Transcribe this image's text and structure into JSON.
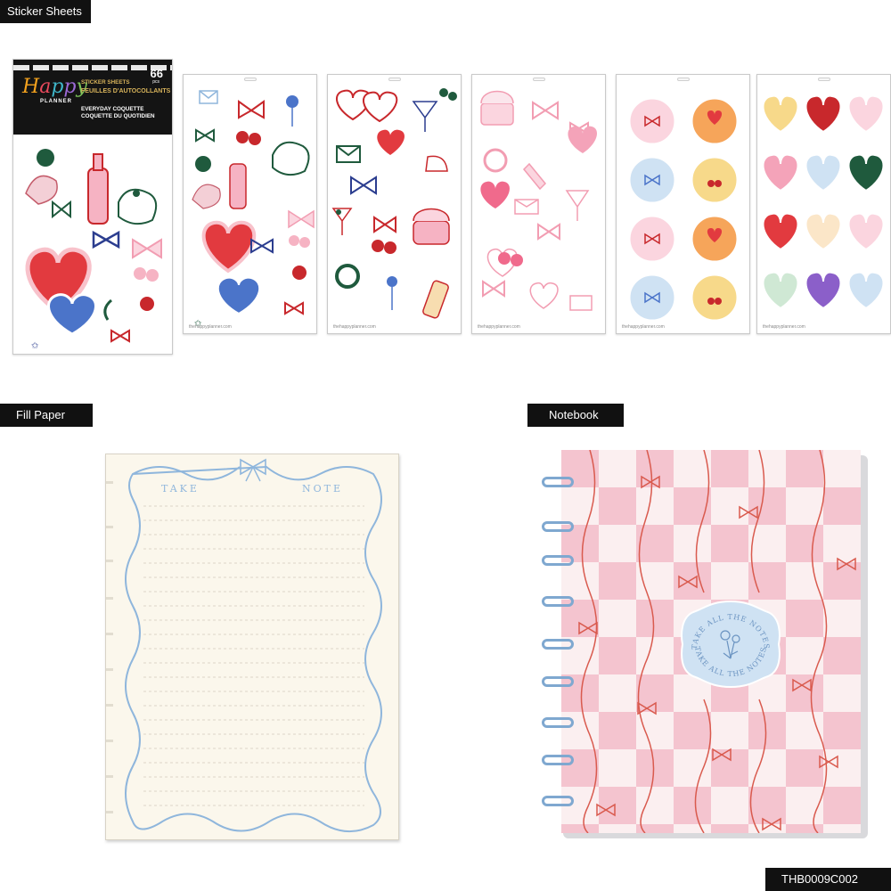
{
  "sections": {
    "sticker_sheets": "Sticker Sheets",
    "fill_paper": "Fill Paper",
    "notebook": "Notebook"
  },
  "product_code": "THB0009C002",
  "pack": {
    "brand_logo": "Happy",
    "brand_sub": "PLANNER",
    "count": "66",
    "count_unit": "pcs",
    "title_en": "STICKER SHEETS",
    "title_fr": "FEUILLES D'AUTOCOLLANTS",
    "theme_en": "EVERYDAY COQUETTE",
    "theme_fr": "COQUETTE DU QUOTIDIEN"
  },
  "fill_paper": {
    "left_title": "TAKE",
    "right_title": "NOTE"
  },
  "notebook": {
    "badge_text_top": "TAKE ALL THE NOTES",
    "badge_text_bottom": "TAKE ALL THE NOTES"
  },
  "sheet_footer": "thehappyplanner.com",
  "colors": {
    "label_bg": "#111111",
    "coquette_pink": "#f4c4cf",
    "check_cream": "#fbeff0",
    "ribbon_red": "#d95a4e",
    "bow_blue": "#8fb6dc",
    "cherry_red": "#c8282c",
    "deep_green": "#1f5a3d"
  }
}
